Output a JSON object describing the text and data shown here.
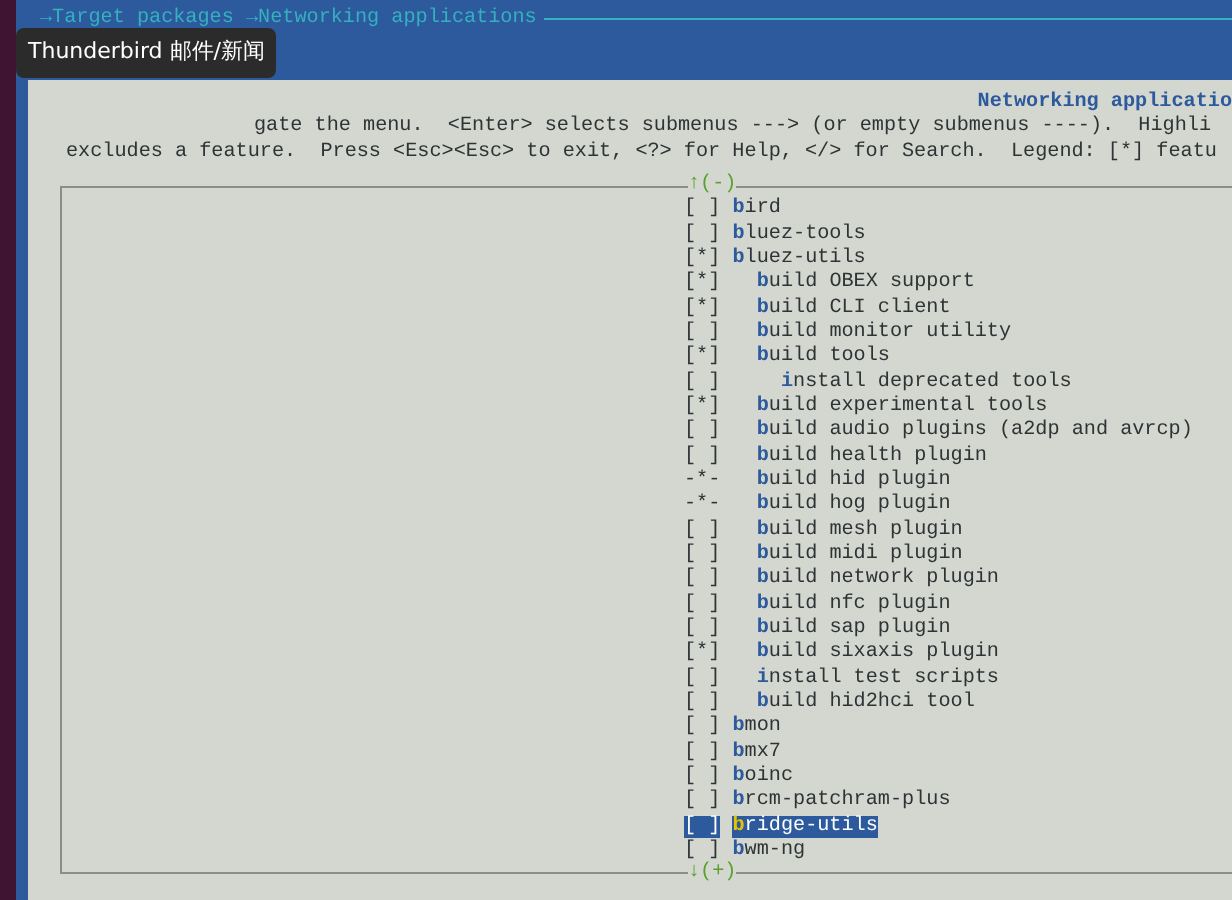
{
  "breadcrumb": "→Target packages →Networking applications",
  "tooltip": "Thunderbird 邮件/新闻",
  "panel": {
    "title": "Networking applicatio",
    "help": [
      "gate the menu.  <Enter> selects submenus ---> (or empty submenus ----).  Highli",
      "excludes a feature.  Press <Esc><Esc> to exit, <?> for Help, </> for Search.  Legend: [*] featu"
    ]
  },
  "menu": {
    "scroll_up": "↑(-)",
    "scroll_down": "↓(+)",
    "items": [
      {
        "mark": "[ ]",
        "label": "bird",
        "selected": false
      },
      {
        "mark": "[ ]",
        "label": "bluez-tools",
        "selected": false
      },
      {
        "mark": "[*]",
        "label": "bluez-utils",
        "selected": false,
        "children": [
          {
            "mark": "[*]",
            "label": "build OBEX support",
            "selected": false
          },
          {
            "mark": "[*]",
            "label": "build CLI client",
            "selected": false
          },
          {
            "mark": "[ ]",
            "label": "build monitor utility",
            "selected": false
          },
          {
            "mark": "[*]",
            "label": "build tools",
            "selected": false,
            "children": [
              {
                "mark": "[ ]",
                "label": "install deprecated tools",
                "selected": false
              }
            ]
          },
          {
            "mark": "[*]",
            "label": "build experimental tools",
            "selected": false
          },
          {
            "mark": "[ ]",
            "label": "build audio plugins (a2dp and avrcp)",
            "selected": false
          },
          {
            "mark": "[ ]",
            "label": "build health plugin",
            "selected": false
          },
          {
            "mark": "-*-",
            "label": "build hid plugin",
            "selected": false
          },
          {
            "mark": "-*-",
            "label": "build hog plugin",
            "selected": false
          },
          {
            "mark": "[ ]",
            "label": "build mesh plugin",
            "selected": false
          },
          {
            "mark": "[ ]",
            "label": "build midi plugin",
            "selected": false
          },
          {
            "mark": "[ ]",
            "label": "build network plugin",
            "selected": false
          },
          {
            "mark": "[ ]",
            "label": "build nfc plugin",
            "selected": false
          },
          {
            "mark": "[ ]",
            "label": "build sap plugin",
            "selected": false
          },
          {
            "mark": "[*]",
            "label": "build sixaxis plugin",
            "selected": false
          },
          {
            "mark": "[ ]",
            "label": "install test scripts",
            "selected": false
          },
          {
            "mark": "[ ]",
            "label": "build hid2hci tool",
            "selected": false
          }
        ]
      },
      {
        "mark": "[ ]",
        "label": "bmon",
        "selected": false
      },
      {
        "mark": "[ ]",
        "label": "bmx7",
        "selected": false
      },
      {
        "mark": "[ ]",
        "label": "boinc",
        "selected": false
      },
      {
        "mark": "[ ]",
        "label": "brcm-patchram-plus",
        "selected": false
      },
      {
        "mark": "[ ]",
        "label": "bridge-utils",
        "selected": true
      },
      {
        "mark": "[ ]",
        "label": "bwm-ng",
        "selected": false
      }
    ]
  }
}
